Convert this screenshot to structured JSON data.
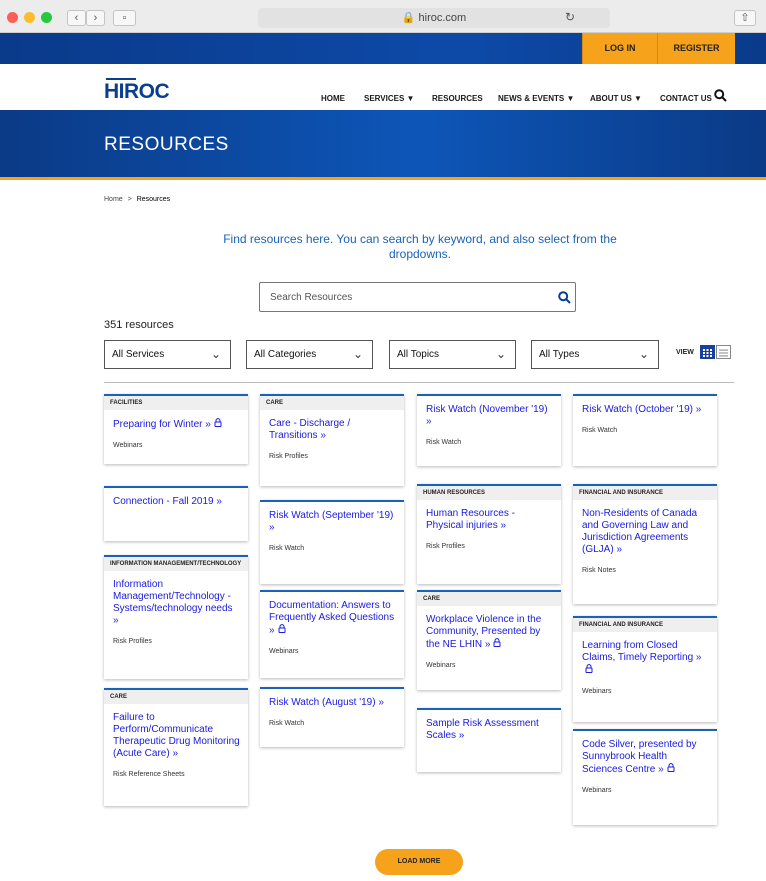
{
  "browser": {
    "url": "hiroc.com"
  },
  "topbar": {
    "login": "LOG IN",
    "register": "REGISTER"
  },
  "logo": "HIROC",
  "nav": {
    "home": "HOME",
    "services": "SERVICES ▼",
    "resources": "RESOURCES",
    "news_events": "NEWS & EVENTS ▼",
    "about_us": "ABOUT US ▼",
    "contact_us": "CONTACT US"
  },
  "hero": {
    "title": "RESOURCES"
  },
  "breadcrumb": {
    "home": "Home",
    "sep": ">",
    "current": "Resources"
  },
  "intro": "Find resources here. You can search by keyword, and also select from the dropdowns.",
  "search": {
    "placeholder": "Search Resources"
  },
  "count": "351 resources",
  "filters": {
    "services": "All Services",
    "categories": "All Categories",
    "topics": "All Topics",
    "types": "All Types"
  },
  "view_label": "VIEW",
  "load_more": "LOAD MORE",
  "colors": {
    "brand_blue": "#0b3d91",
    "accent_orange": "#f6a21b",
    "link_blue": "#1a1ae0"
  },
  "cards": [
    {
      "cat": "FACILITIES",
      "title": "Preparing for Winter »",
      "lock": true,
      "type": "Webinars"
    },
    {
      "cat": "",
      "title": "Connection - Fall 2019 »",
      "lock": false,
      "type": ""
    },
    {
      "cat": "INFORMATION MANAGEMENT/TECHNOLOGY",
      "title": "Information Management/Technology - Systems/technology needs »",
      "lock": false,
      "type": "Risk Profiles"
    },
    {
      "cat": "CARE",
      "title": "Failure to Perform/Communicate Therapeutic Drug Monitoring (Acute Care) »",
      "lock": false,
      "type": "Risk Reference Sheets"
    },
    {
      "cat": "CARE",
      "title": "Care - Discharge / Transitions »",
      "lock": false,
      "type": "Risk Profiles"
    },
    {
      "cat": "",
      "title": "Risk Watch (September '19) »",
      "lock": false,
      "type": "Risk Watch"
    },
    {
      "cat": "",
      "title": "Documentation: Answers to Frequently Asked Questions »",
      "lock": true,
      "type": "Webinars"
    },
    {
      "cat": "",
      "title": "Risk Watch (August '19) »",
      "lock": false,
      "type": "Risk Watch"
    },
    {
      "cat": "",
      "title": "Risk Watch (November '19) »",
      "lock": false,
      "type": "Risk Watch"
    },
    {
      "cat": "HUMAN RESOURCES",
      "title": "Human Resources - Physical injuries »",
      "lock": false,
      "type": "Risk Profiles"
    },
    {
      "cat": "CARE",
      "title": "Workplace Violence in the Community, Presented by the NE LHIN »",
      "lock": true,
      "type": "Webinars"
    },
    {
      "cat": "",
      "title": "Sample Risk Assessment Scales »",
      "lock": false,
      "type": ""
    },
    {
      "cat": "",
      "title": "Risk Watch (October '19) »",
      "lock": false,
      "type": "Risk Watch"
    },
    {
      "cat": "FINANCIAL AND INSURANCE",
      "title": "Non-Residents of Canada and Governing Law and Jurisdiction Agreements (GLJA) »",
      "lock": false,
      "type": "Risk Notes"
    },
    {
      "cat": "FINANCIAL AND INSURANCE",
      "title": "Learning from Closed Claims, Timely Reporting »",
      "lock": true,
      "type": "Webinars"
    },
    {
      "cat": "",
      "title": "Code Silver, presented by Sunnybrook Health Sciences Centre »",
      "lock": true,
      "type": "Webinars"
    }
  ]
}
